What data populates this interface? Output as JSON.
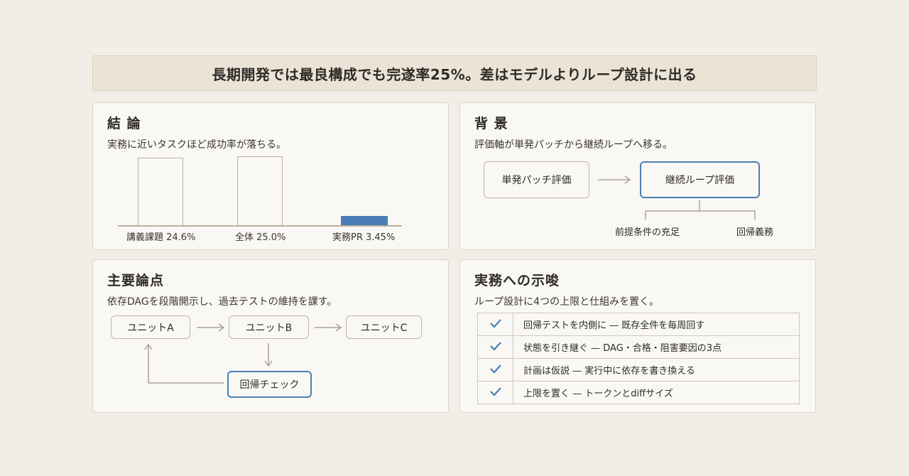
{
  "banner": {
    "title": "長期開発では最良構成でも完遂率25%。差はモデルよりループ設計に出る"
  },
  "conclusion": {
    "title": "結 論",
    "subtitle": "実務に近いタスクほど成功率が落ちる。",
    "chart_data": {
      "type": "bar",
      "categories": [
        "講義課題",
        "全体",
        "実務PR"
      ],
      "values": [
        24.6,
        25.0,
        3.45
      ],
      "labels": [
        "講義課題 24.6%",
        "全体 25.0%",
        "実務PR 3.45%"
      ],
      "unit": "%",
      "highlight_color": "#4a7eb5"
    }
  },
  "background": {
    "title": "背 景",
    "subtitle": "評価軸が単発パッチから継続ループへ移る。",
    "from_box": "単発パッチ評価",
    "to_box": "継続ループ評価",
    "branches": [
      "前提条件の充足",
      "回帰義務"
    ]
  },
  "points": {
    "title": "主要論点",
    "subtitle": "依存DAGを段階開示し、過去テストの維持を課す。",
    "units": [
      "ユニットA",
      "ユニットB",
      "ユニットC"
    ],
    "check_box": "回帰チェック"
  },
  "implications": {
    "title": "実務への示唆",
    "subtitle": "ループ設計に4つの上限と仕組みを置く。",
    "check_icon": "check-icon",
    "rows": [
      "回帰テストを内側に — 既存全件を毎周回す",
      "状態を引き継ぐ — DAG・合格・阻害要因の3点",
      "計画は仮説 — 実行中に依存を書き換える",
      "上限を置く — トークンとdiffサイズ"
    ]
  }
}
